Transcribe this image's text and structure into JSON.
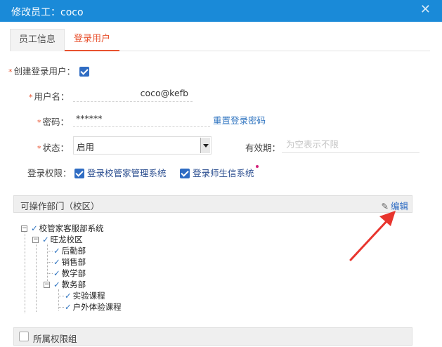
{
  "dialog": {
    "title": "修改员工：coco",
    "close_glyph": "✕"
  },
  "tabs": [
    {
      "label": "员工信息",
      "active": false
    },
    {
      "label": "登录用户",
      "active": true
    }
  ],
  "form": {
    "required_mark": "*",
    "create_login": {
      "label": "创建登录用户：",
      "checked": true
    },
    "username": {
      "label": "用户名：",
      "value": "coco@kefb"
    },
    "password": {
      "label": "密码：",
      "value": "******",
      "reset_link": "重置登录密码"
    },
    "status": {
      "label": "状态：",
      "value": "启用"
    },
    "validity": {
      "label": "有效期：",
      "placeholder": "为空表示不限"
    },
    "login_permission": {
      "label": "登录权限：",
      "options": [
        {
          "label": "登录校管家管理系统",
          "checked": true
        },
        {
          "label": "登录师生信系统",
          "checked": true
        }
      ]
    }
  },
  "departments": {
    "title": "可操作部门（校区）",
    "edit_label": "编辑",
    "tree": [
      {
        "label": "校管家客服部系统",
        "toggle": "−"
      },
      {
        "label": "旺龙校区",
        "toggle": "−"
      },
      {
        "label": "后勤部"
      },
      {
        "label": "销售部"
      },
      {
        "label": "教学部"
      },
      {
        "label": "教务部",
        "toggle": "−"
      },
      {
        "label": "实验课程"
      },
      {
        "label": "户外体验课程"
      }
    ]
  },
  "permission_group": {
    "title": "所属权限组",
    "checked": false
  },
  "annotation": {
    "arrow_color": "#e8352e"
  },
  "colors": {
    "header": "#1a8ad8",
    "accent": "#e8522f",
    "checkbox": "#2f6cc3",
    "link": "#2f74c0"
  }
}
